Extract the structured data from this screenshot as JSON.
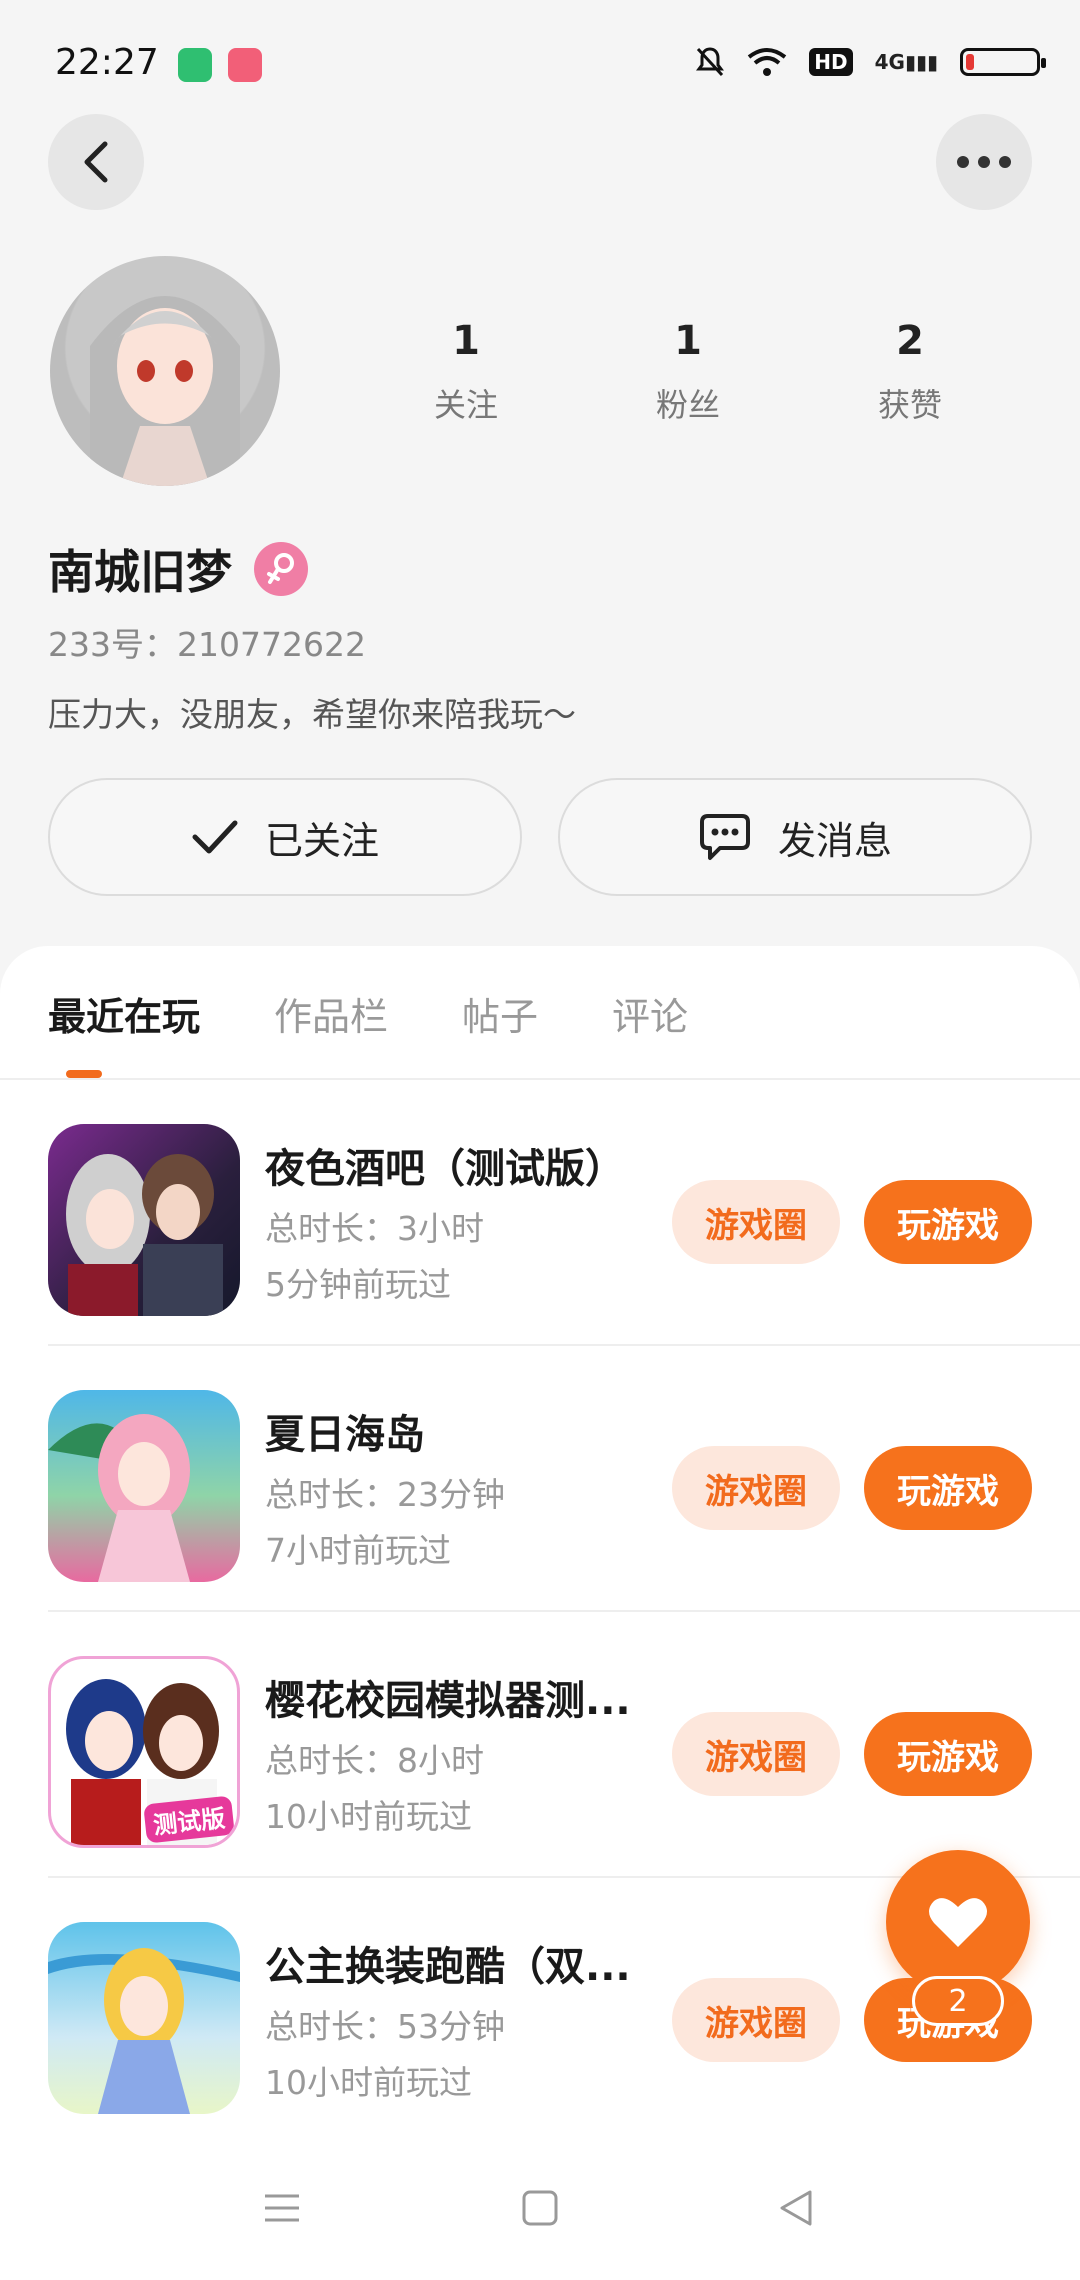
{
  "status_bar": {
    "time": "22:27",
    "network": "4G",
    "hd": "HD"
  },
  "profile": {
    "stats": [
      {
        "value": "1",
        "label": "关注"
      },
      {
        "value": "1",
        "label": "粉丝"
      },
      {
        "value": "2",
        "label": "获赞"
      }
    ],
    "nickname": "南城旧梦",
    "uid": "233号：210772622",
    "bio": "压力大，没朋友，希望你来陪我玩～",
    "follow_button": "已关注",
    "message_button": "发消息"
  },
  "tabs": [
    {
      "label": "最近在玩",
      "active": true
    },
    {
      "label": "作品栏",
      "active": false
    },
    {
      "label": "帖子",
      "active": false
    },
    {
      "label": "评论",
      "active": false
    }
  ],
  "games": [
    {
      "title": "夜色酒吧（测试版）",
      "duration": "总时长：3小时",
      "last_played": "5分钟前玩过",
      "circle_label": "游戏圈",
      "play_label": "玩游戏"
    },
    {
      "title": "夏日海岛",
      "duration": "总时长：23分钟",
      "last_played": "7小时前玩过",
      "circle_label": "游戏圈",
      "play_label": "玩游戏"
    },
    {
      "title": "樱花校园模拟器测...",
      "duration": "总时长：8小时",
      "last_played": "10小时前玩过",
      "circle_label": "游戏圈",
      "play_label": "玩游戏",
      "icon_badge": "测试版"
    },
    {
      "title": "公主换装跑酷（双...",
      "duration": "总时长：53分钟",
      "last_played": "10小时前玩过",
      "circle_label": "游戏圈",
      "play_label": "玩游戏"
    }
  ],
  "like_fab": {
    "count": "2"
  },
  "colors": {
    "accent": "#f6721c",
    "accent_light": "#fde7dc",
    "gender": "#f07ea5"
  }
}
